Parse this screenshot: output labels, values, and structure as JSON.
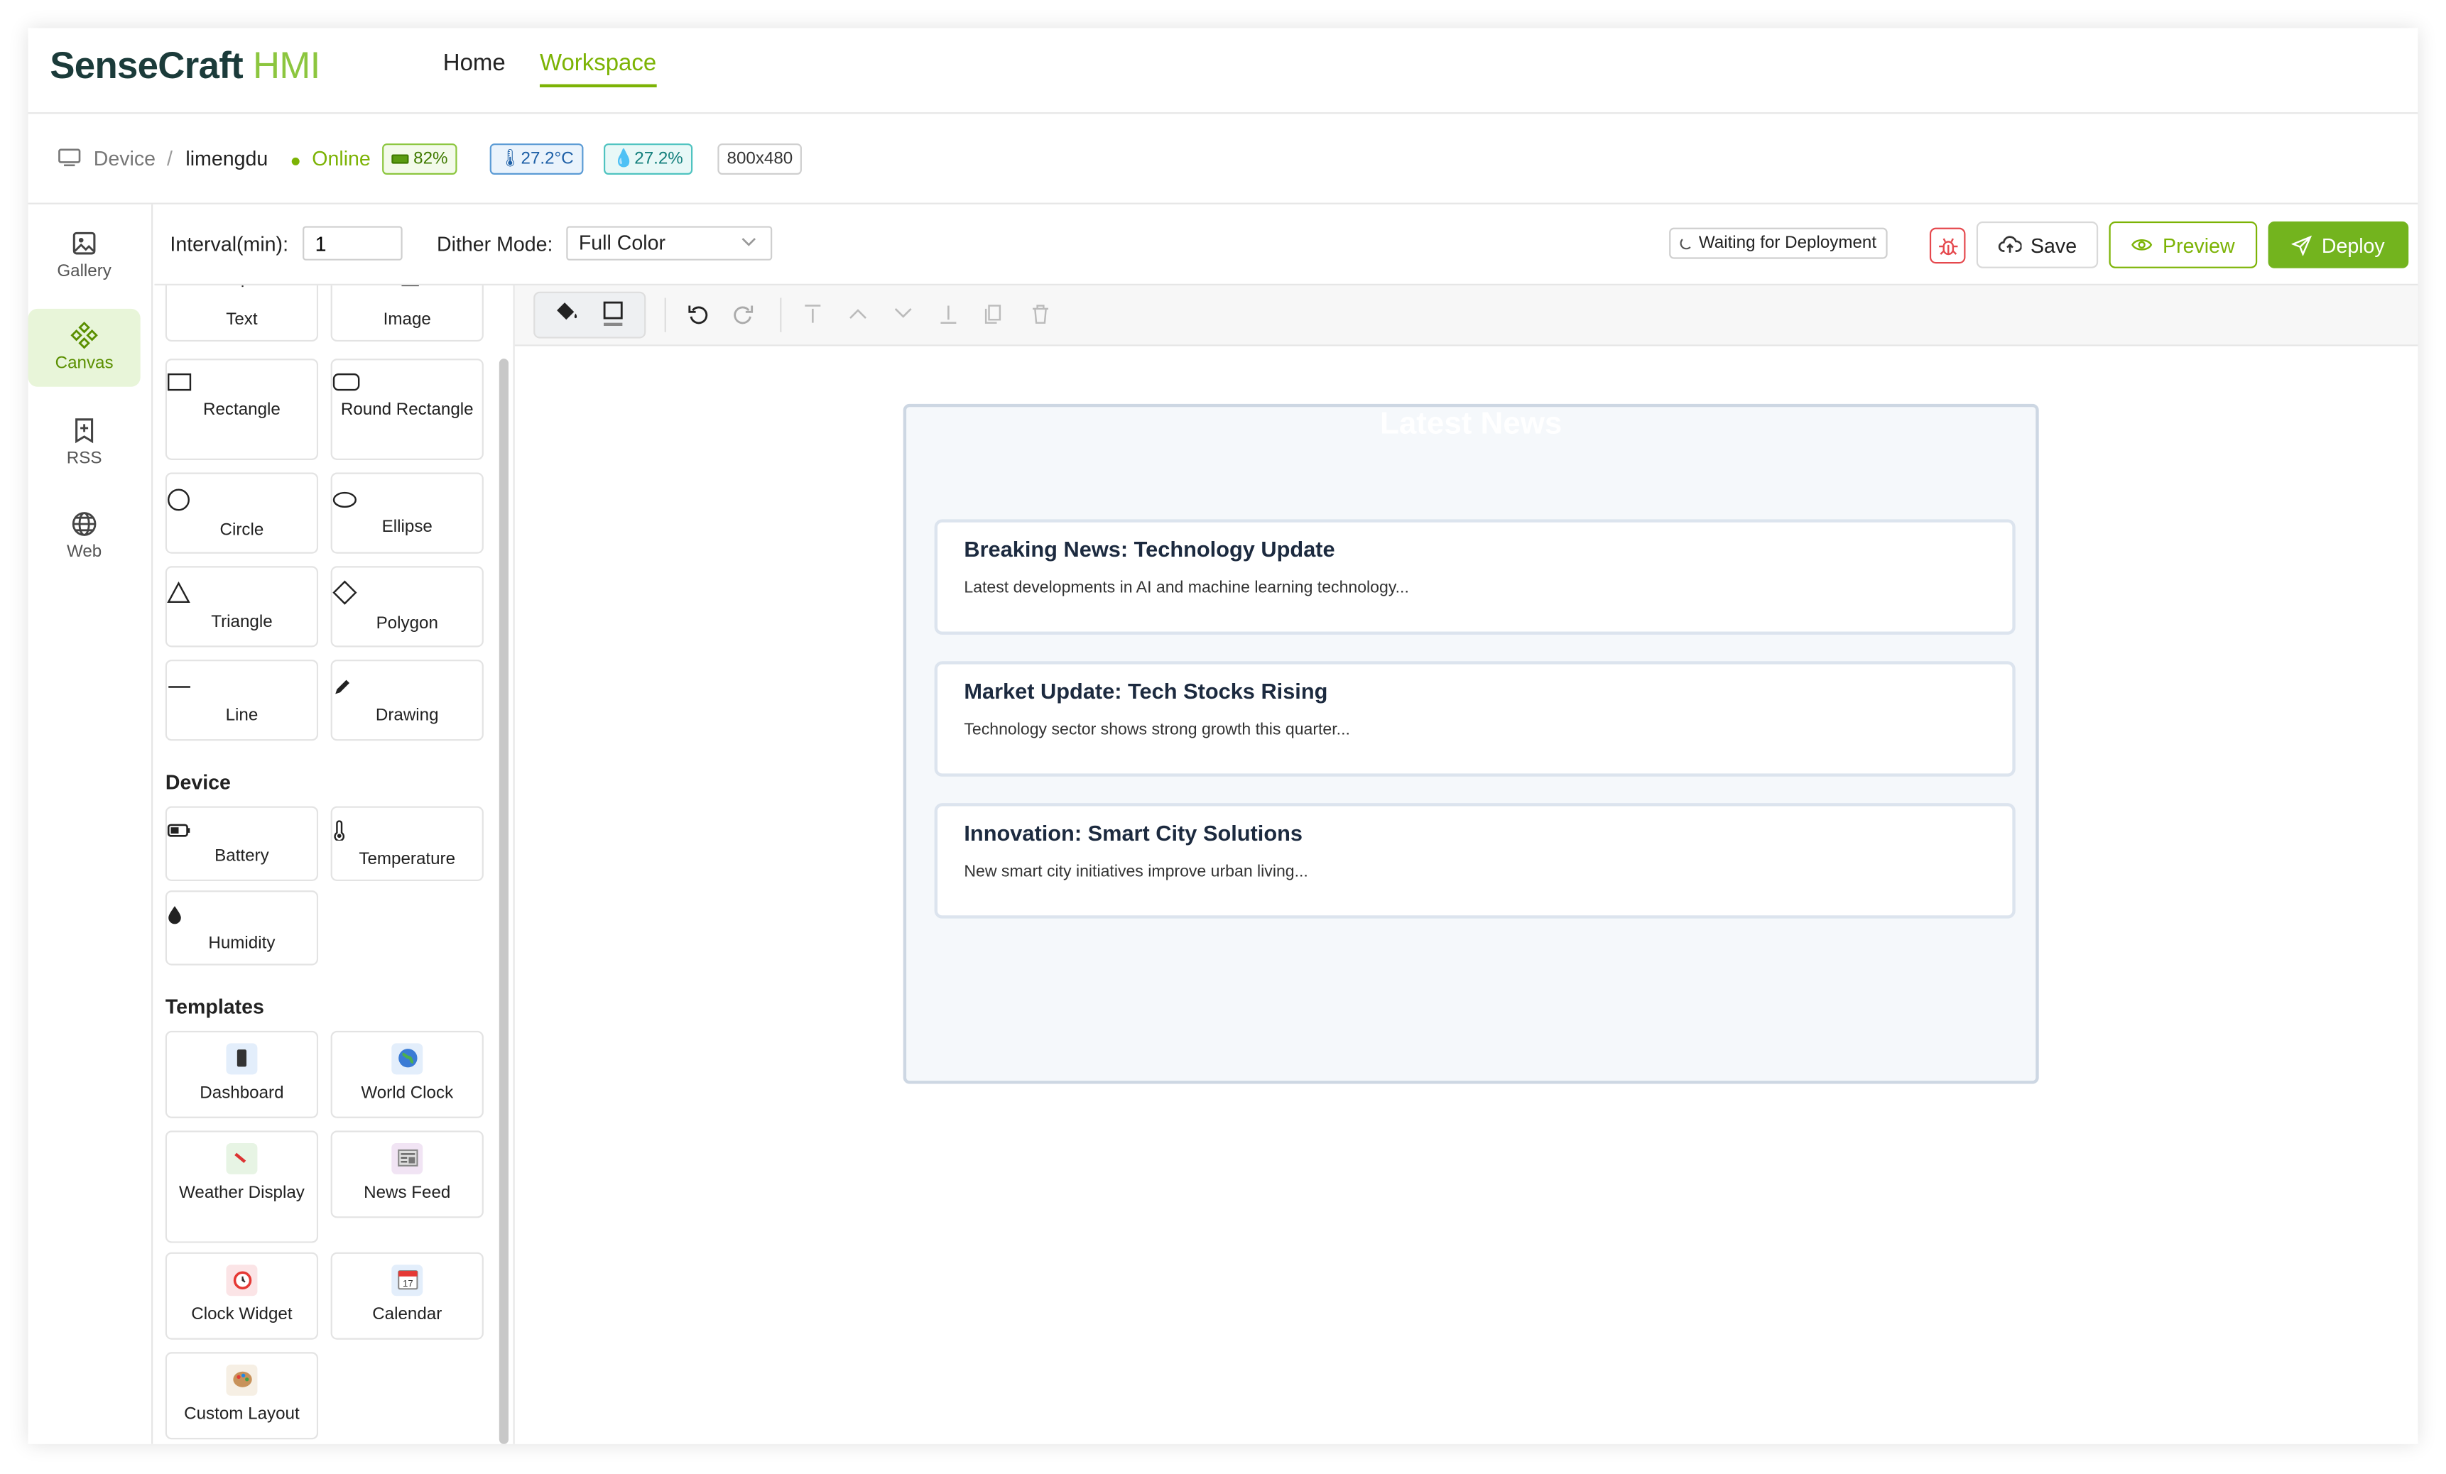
{
  "app": {
    "logo_main": "SenseCraft",
    "logo_accent": "HMI"
  },
  "nav": {
    "home": "Home",
    "workspace": "Workspace"
  },
  "device": {
    "label": "Device",
    "separator": "/",
    "name": "limengdu",
    "status": "Online",
    "battery": "82%",
    "temperature": "27.2°C",
    "humidity": "27.2%",
    "resolution": "800x480"
  },
  "sidebar": {
    "items": [
      {
        "label": "Gallery",
        "icon": "image-icon"
      },
      {
        "label": "Canvas",
        "icon": "canvas-icon"
      },
      {
        "label": "RSS",
        "icon": "bookmark-plus-icon"
      },
      {
        "label": "Web",
        "icon": "globe-icon"
      }
    ]
  },
  "toolbar": {
    "interval_label": "Interval(min):",
    "interval_value": "1",
    "dither_label": "Dither Mode:",
    "dither_value": "Full Color",
    "status": "Waiting for Deployment",
    "save": "Save",
    "preview": "Preview",
    "deploy": "Deploy"
  },
  "palette": {
    "basic": [
      {
        "label": "Text",
        "icon": "text-icon"
      },
      {
        "label": "Image",
        "icon": "image-icon"
      },
      {
        "label": "Rectangle",
        "icon": "rectangle-icon"
      },
      {
        "label": "Round Rectangle",
        "icon": "round-rectangle-icon"
      },
      {
        "label": "Circle",
        "icon": "circle-icon"
      },
      {
        "label": "Ellipse",
        "icon": "ellipse-icon"
      },
      {
        "label": "Triangle",
        "icon": "triangle-icon"
      },
      {
        "label": "Polygon",
        "icon": "polygon-icon"
      },
      {
        "label": "Line",
        "icon": "line-icon"
      },
      {
        "label": "Drawing",
        "icon": "pencil-icon"
      }
    ],
    "device_title": "Device",
    "device": [
      {
        "label": "Battery",
        "icon": "battery-icon"
      },
      {
        "label": "Temperature",
        "icon": "thermometer-icon"
      },
      {
        "label": "Humidity",
        "icon": "droplet-icon"
      }
    ],
    "templates_title": "Templates",
    "templates": [
      {
        "label": "Dashboard",
        "icon": "phone-icon"
      },
      {
        "label": "World Clock",
        "icon": "globe-icon"
      },
      {
        "label": "Weather Display",
        "icon": "weather-icon"
      },
      {
        "label": "News Feed",
        "icon": "newspaper-icon"
      },
      {
        "label": "Clock Widget",
        "icon": "alarm-clock-icon"
      },
      {
        "label": "Calendar",
        "icon": "calendar-icon"
      },
      {
        "label": "Custom Layout",
        "icon": "palette-icon"
      }
    ]
  },
  "canvas": {
    "title": "Latest News",
    "cards": [
      {
        "title": "Breaking News: Technology Update",
        "body": "Latest developments in AI and machine learning technology..."
      },
      {
        "title": "Market Update: Tech Stocks Rising",
        "body": "Technology sector shows strong growth this quarter..."
      },
      {
        "title": "Innovation: Smart City Solutions",
        "body": "New smart city initiatives improve urban living..."
      }
    ]
  },
  "colors": {
    "accent": "#7cb305",
    "deploy": "#73b41e",
    "danger": "#e5484d"
  }
}
